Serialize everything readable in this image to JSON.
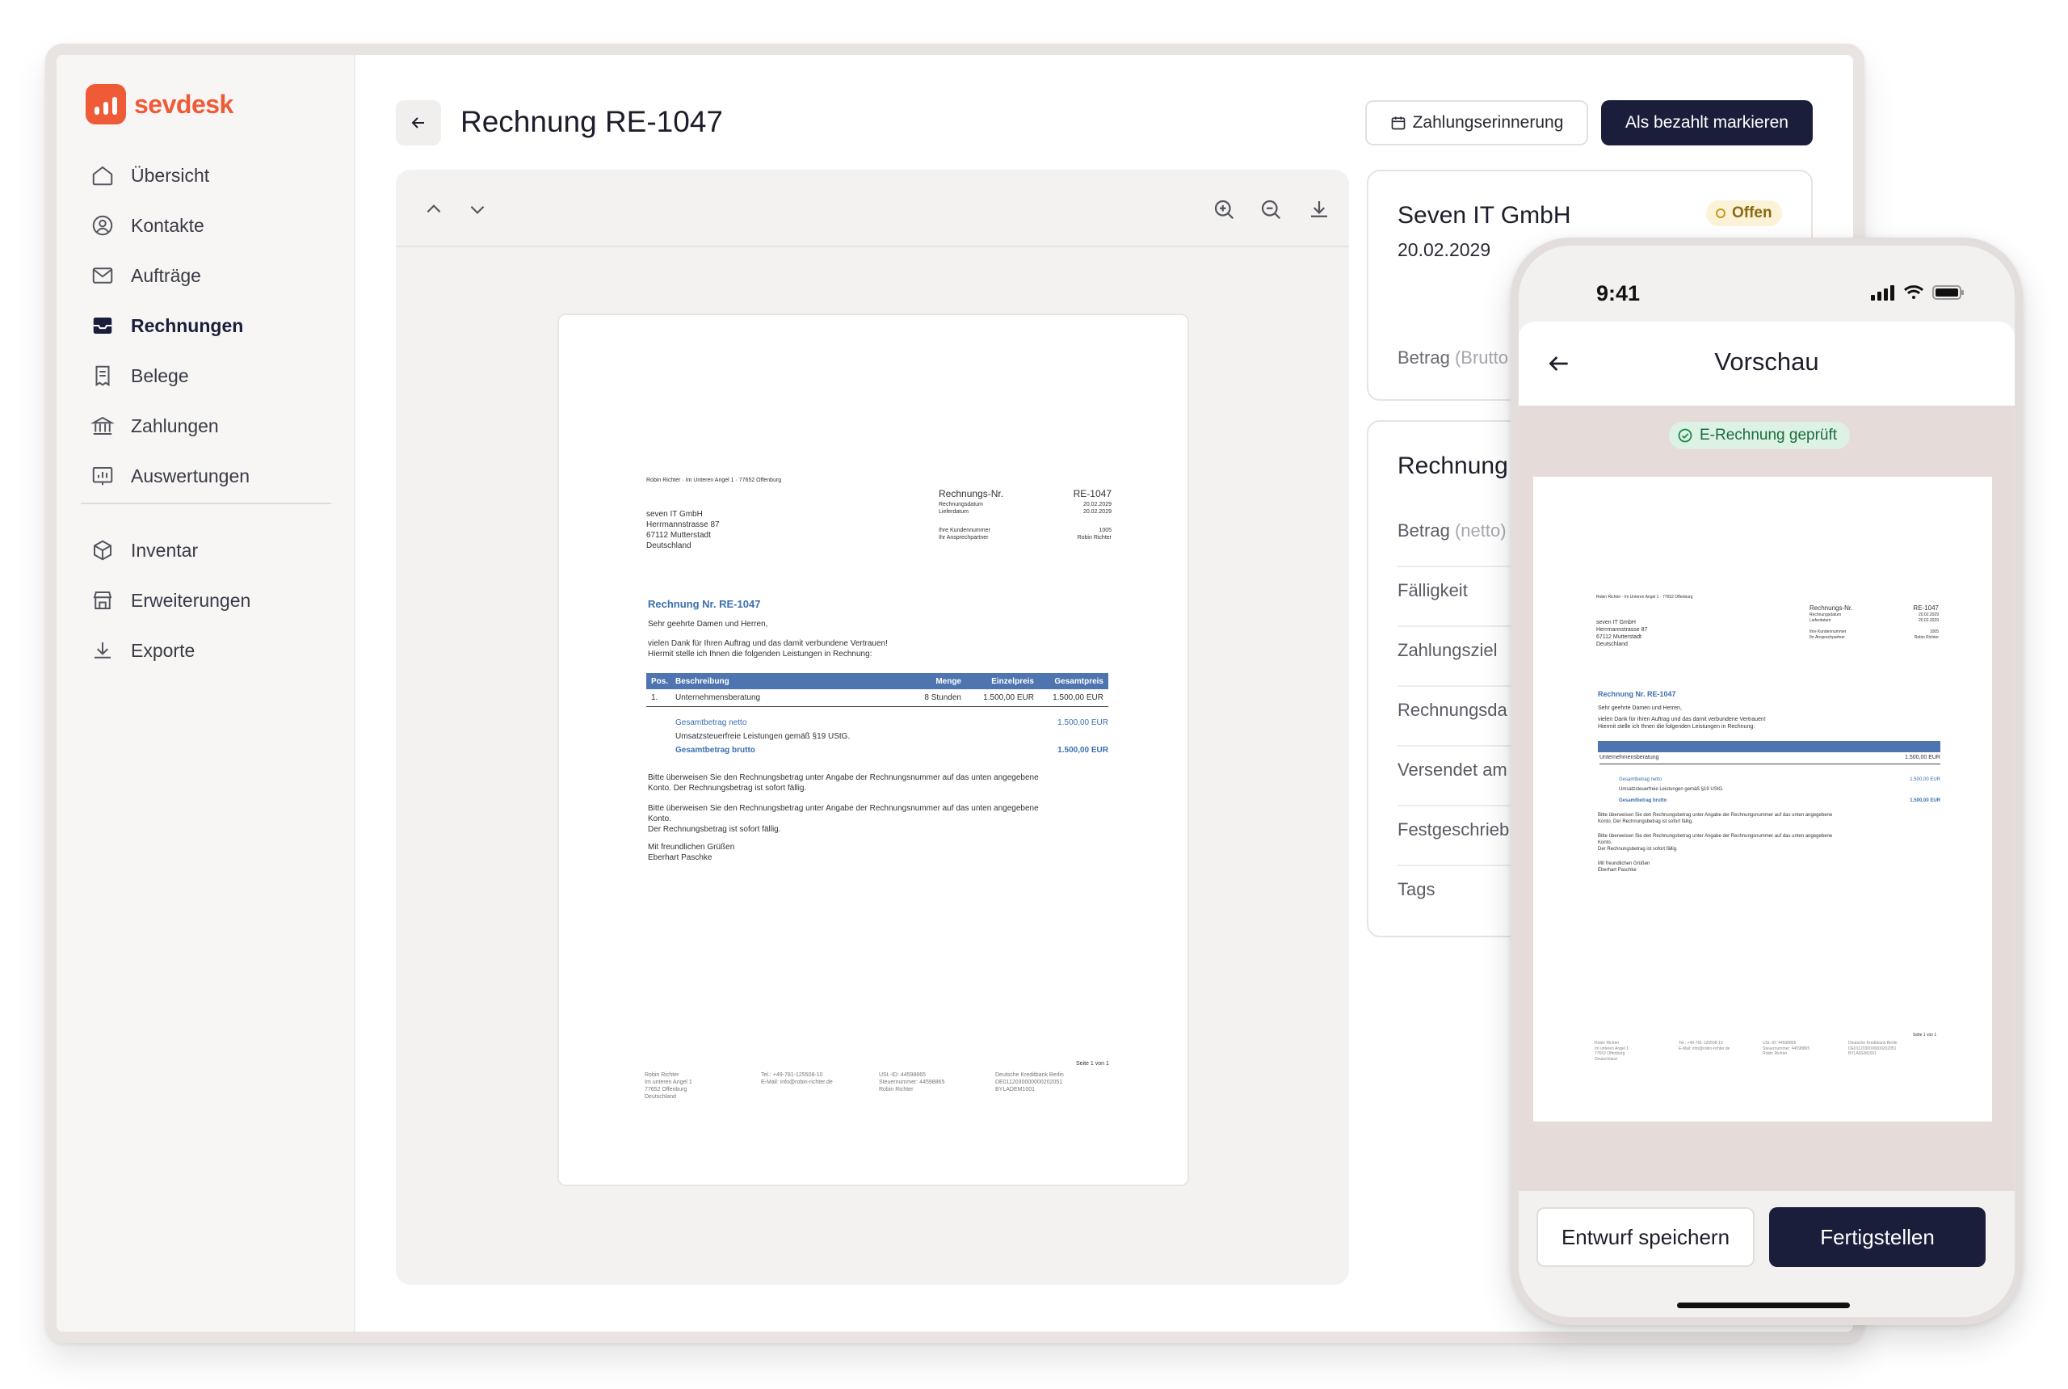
{
  "brand": {
    "name": "sevdesk",
    "color": "#ef5a37"
  },
  "sidebar": {
    "items": [
      {
        "label": "Übersicht",
        "icon": "home-icon"
      },
      {
        "label": "Kontakte",
        "icon": "contacts-icon"
      },
      {
        "label": "Aufträge",
        "icon": "mail-icon"
      },
      {
        "label": "Rechnungen",
        "icon": "invoice-inbox-icon",
        "active": true
      },
      {
        "label": "Belege",
        "icon": "receipt-icon"
      },
      {
        "label": "Zahlungen",
        "icon": "bank-icon"
      },
      {
        "label": "Auswertungen",
        "icon": "chart-icon"
      }
    ],
    "items2": [
      {
        "label": "Inventar",
        "icon": "box-icon"
      },
      {
        "label": "Erweiterungen",
        "icon": "store-icon"
      },
      {
        "label": "Exporte",
        "icon": "download-icon"
      }
    ]
  },
  "header": {
    "title": "Rechnung RE-1047",
    "reminder_label": "Zahlungserinnerung",
    "mark_paid_label": "Als bezahlt markieren"
  },
  "details": {
    "company": "Seven IT GmbH",
    "date": "20.02.2029",
    "status": "Offen",
    "betrag_label": "Betrag",
    "betrag_hint": "(Brutto"
  },
  "info": {
    "title": "Rechnung",
    "rows": [
      {
        "label": "Betrag",
        "hint": "(netto)"
      },
      {
        "label": "Fälligkeit",
        "hint": ""
      },
      {
        "label": "Zahlungsziel",
        "hint": ""
      },
      {
        "label": "Rechnungsda",
        "hint": ""
      },
      {
        "label": "Versendet am",
        "hint": ""
      },
      {
        "label": "Festgeschrieb",
        "hint": ""
      },
      {
        "label": "Tags",
        "hint": ""
      }
    ]
  },
  "document": {
    "sender_line": "Robin Richter · Im Unteren Angel 1 · 77652 Offenburg",
    "recipient": [
      "seven IT GmbH",
      "Herrmannstrasse 87",
      "67112 Mutterstadt",
      "Deutschland"
    ],
    "meta": [
      {
        "label": "Rechnungs-Nr.",
        "value": "RE-1047"
      },
      {
        "label": "Rechnungsdatum",
        "value": "20.02.2029"
      },
      {
        "label": "Lieferdatum",
        "value": "20.02.2029"
      },
      {
        "label": "Ihre Kundennummer",
        "value": "1005"
      },
      {
        "label": "Ihr Ansprechpartner",
        "value": "Robin Richter"
      }
    ],
    "heading": "Rechnung Nr. RE-1047",
    "greeting": "Sehr geehrte Damen und Herren,",
    "intro1": "vielen Dank für Ihren Auftrag und das damit verbundene Vertrauen!",
    "intro2": "Hiermit stelle ich Ihnen die folgenden Leistungen in Rechnung:",
    "table_headers": [
      "Pos.",
      "Beschreibung",
      "Menge",
      "Einzelpreis",
      "Gesamtpreis"
    ],
    "table_row": [
      "1.",
      "Unternehmensberatung",
      "8 Stunden",
      "1.500,00 EUR",
      "1.500,00 EUR"
    ],
    "net_label": "Gesamtbetrag netto",
    "net_value": "1.500,00 EUR",
    "tax_note": "Umsatzsteuerfreie Leistungen gemäß §19 UStG.",
    "gross_label": "Gesamtbetrag brutto",
    "gross_value": "1.500,00 EUR",
    "pay1": "Bitte überweisen Sie den Rechnungsbetrag unter Angabe der Rechnungsnummer auf das unten angegebene",
    "pay1b": "Konto. Der Rechnungsbetrag ist sofort fällig.",
    "pay2": "Bitte überweisen Sie den Rechnungsbetrag unter Angabe der Rechnungsnummer auf das unten angegebene",
    "pay2b": "Konto.",
    "pay2c": "Der Rechnungsbetrag ist sofort fällig.",
    "closing1": "Mit freundlichen Grüßen",
    "closing2": "Eberhart Paschke",
    "page_no": "Seite 1 von 1",
    "footer_cols": [
      [
        "Robin Richter",
        "Im unteren Angel 1",
        "77652 Offenburg",
        "Deutschland"
      ],
      [
        "Tel.: +49-781-125508-10",
        "E-Mail: info@robin-richter.de"
      ],
      [
        "USt.-ID: 44598865",
        "Steuernummer: 44598865",
        "Robin Richter"
      ],
      [
        "Deutsche Kreditbank Berlin",
        "DE0112030000000202051",
        "BYLADEM1001"
      ]
    ]
  },
  "phone": {
    "time": "9:41",
    "title": "Vorschau",
    "erechnung": "E-Rechnung geprüft",
    "draft_label": "Entwurf speichern",
    "finish_label": "Fertigstellen"
  }
}
